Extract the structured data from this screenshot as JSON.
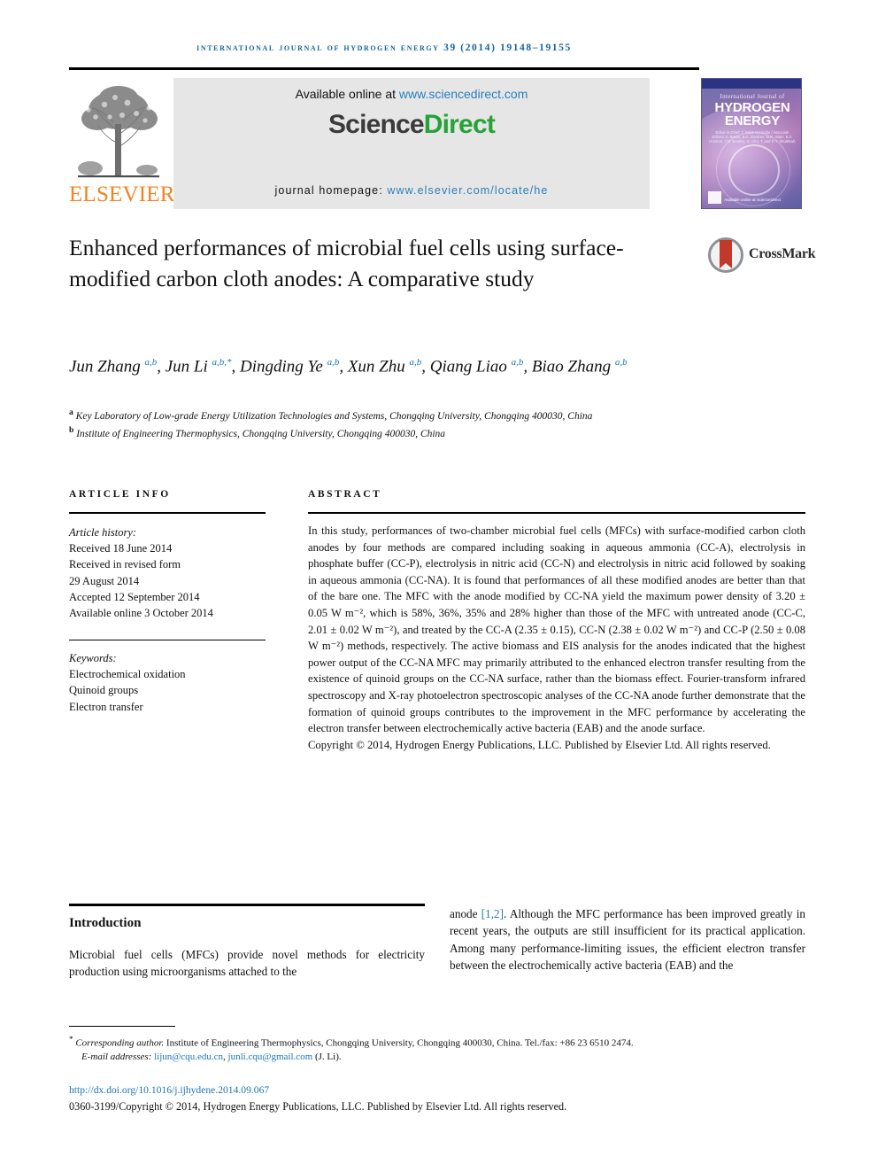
{
  "running_head": "International Journal of Hydrogen Energy 39 (2014) 19148–19155",
  "banner": {
    "available_text": "Available online at ",
    "sciencedirect_url": "www.sciencedirect.com",
    "logo_part1": "Science",
    "logo_part2": "Direct",
    "homepage_label": "journal homepage: ",
    "homepage_url": "www.elsevier.com/locate/he"
  },
  "publisher": {
    "name": "ELSEVIER"
  },
  "cover": {
    "top_line": "International Journal of",
    "title_line1": "HYDROGEN",
    "title_line2": "ENERGY",
    "editors": "Editor-in-Chief: T. Nejat Veziroğlu / Associate Editors: A. Bashir, B.C. Gardner, M.R. Islam, B.Z. Hornton, J.M. Beatley, G. Cho, T. and D.Y. Shuttlewb",
    "bottom": "Available online at ScienceDirect"
  },
  "crossmark": {
    "label": "CrossMark"
  },
  "title": "Enhanced performances of microbial fuel cells using surface-modified carbon cloth anodes: A comparative study",
  "authors": [
    {
      "name": "Jun Zhang",
      "marks": "a,b"
    },
    {
      "name": "Jun Li",
      "marks": "a,b,*"
    },
    {
      "name": "Dingding Ye",
      "marks": "a,b"
    },
    {
      "name": "Xun Zhu",
      "marks": "a,b"
    },
    {
      "name": "Qiang Liao",
      "marks": "a,b"
    },
    {
      "name": "Biao Zhang",
      "marks": "a,b"
    }
  ],
  "affiliations": [
    {
      "mark": "a",
      "text": "Key Laboratory of Low-grade Energy Utilization Technologies and Systems, Chongqing University, Chongqing 400030, China"
    },
    {
      "mark": "b",
      "text": "Institute of Engineering Thermophysics, Chongqing University, Chongqing 400030, China"
    }
  ],
  "article_info": {
    "heading": "ARTICLE INFO",
    "history_label": "Article history:",
    "history": [
      "Received 18 June 2014",
      "Received in revised form",
      "29 August 2014",
      "Accepted 12 September 2014",
      "Available online 3 October 2014"
    ],
    "keywords_label": "Keywords:",
    "keywords": [
      "Electrochemical oxidation",
      "Quinoid groups",
      "Electron transfer"
    ]
  },
  "abstract": {
    "heading": "ABSTRACT",
    "text": "In this study, performances of two-chamber microbial fuel cells (MFCs) with surface-modified carbon cloth anodes by four methods are compared including soaking in aqueous ammonia (CC-A), electrolysis in phosphate buffer (CC-P), electrolysis in nitric acid (CC-N) and electrolysis in nitric acid followed by soaking in aqueous ammonia (CC-NA). It is found that performances of all these modified anodes are better than that of the bare one. The MFC with the anode modified by CC-NA yield the maximum power density of 3.20 ± 0.05 W m⁻², which is 58%, 36%, 35% and 28% higher than those of the MFC with untreated anode (CC-C, 2.01 ± 0.02 W m⁻²), and treated by the CC-A (2.35 ± 0.15), CC-N (2.38 ± 0.02 W m⁻²) and CC-P (2.50 ± 0.08 W m⁻²) methods, respectively. The active biomass and EIS analysis for the anodes indicated that the highest power output of the CC-NA MFC may primarily attributed to the enhanced electron transfer resulting from the existence of quinoid groups on the CC-NA surface, rather than the biomass effect. Fourier-transform infrared spectroscopy and X-ray photoelectron spectroscopic analyses of the CC-NA anode further demonstrate that the formation of quinoid groups contributes to the improvement in the MFC performance by accelerating the electron transfer between electrochemically active bacteria (EAB) and the anode surface.",
    "copyright": "Copyright © 2014, Hydrogen Energy Publications, LLC. Published by Elsevier Ltd. All rights reserved."
  },
  "body": {
    "section_title": "Introduction",
    "left_text": "Microbial fuel cells (MFCs) provide novel methods for electricity production using microorganisms attached to the",
    "right_prefix": "anode ",
    "right_citation": "[1,2]",
    "right_text": ". Although the MFC performance has been improved greatly in recent years, the outputs are still insufficient for its practical application. Among many performance-limiting issues, the efficient electron transfer between the electrochemically active bacteria (EAB) and the"
  },
  "footnotes": {
    "corresponding_marker": "*",
    "corresponding_label": "Corresponding author.",
    "corresponding_text": " Institute of Engineering Thermophysics, Chongqing University, Chongqing 400030, China. Tel./fax: +86 23 6510 2474.",
    "email_label": "E-mail addresses: ",
    "email1": "lijun@cqu.edu.cn",
    "email_sep": ", ",
    "email2": "junli.cqu@gmail.com",
    "email_suffix": " (J. Li).",
    "doi": "http://dx.doi.org/10.1016/j.ijhydene.2014.09.067",
    "issn_line": "0360-3199/Copyright © 2014, Hydrogen Energy Publications, LLC. Published by Elsevier Ltd. All rights reserved."
  },
  "colors": {
    "link_blue": "#1d76b5",
    "banner_blue": "#2a7fbd",
    "sciencedirect_green": "#25a338",
    "elsevier_orange": "#f4821f",
    "crossmark_red": "#c0392b"
  }
}
